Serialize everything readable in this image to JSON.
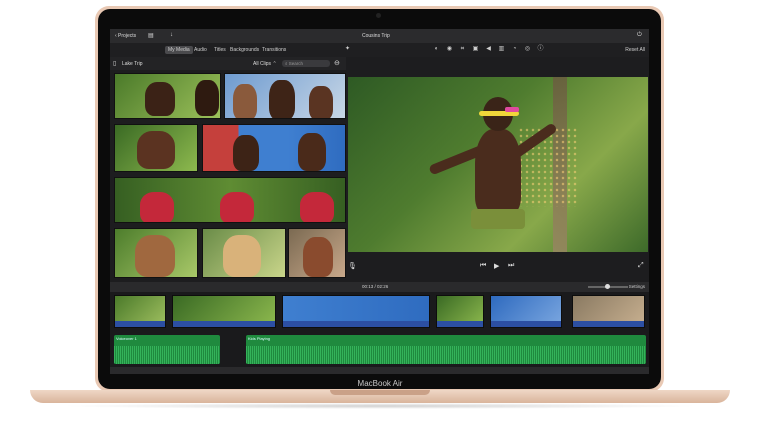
{
  "device": {
    "brand": "MacBook Air"
  },
  "toolbar": {
    "projects": "‹ Projects",
    "title": "Cousins Trip",
    "reset_all": "Reset All"
  },
  "browser_tabs": [
    {
      "label": "My Media",
      "active": true
    },
    {
      "label": "Audio",
      "active": false
    },
    {
      "label": "Titles",
      "active": false
    },
    {
      "label": "Backgrounds",
      "active": false
    },
    {
      "label": "Transitions",
      "active": false
    }
  ],
  "library": {
    "name": "Lake Trip",
    "filter": "All Clips ⌃",
    "search_placeholder": "Search"
  },
  "timecode": "00:13 / 02:26",
  "timeline": {
    "settings_label": "Settings",
    "audio_tracks": [
      {
        "label": "Voiceover 1"
      },
      {
        "label": "Kids Playing"
      }
    ]
  },
  "colors": {
    "accent_audio": "#1f8a3e",
    "clip_strip": "#2c4fa3",
    "headband": "#f0d63a"
  }
}
